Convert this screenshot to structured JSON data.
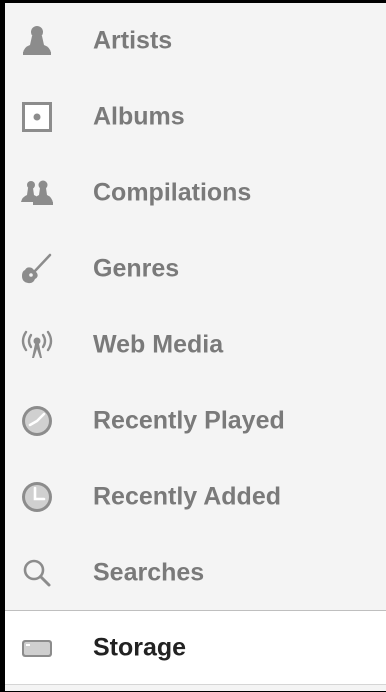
{
  "menu": {
    "items": [
      {
        "label": "Artists",
        "icon": "artist-icon"
      },
      {
        "label": "Albums",
        "icon": "album-icon"
      },
      {
        "label": "Compilations",
        "icon": "compilations-icon"
      },
      {
        "label": "Genres",
        "icon": "guitar-icon"
      },
      {
        "label": "Web Media",
        "icon": "broadcast-icon"
      },
      {
        "label": "Recently Played",
        "icon": "clock-icon"
      },
      {
        "label": "Recently Added",
        "icon": "clock-icon"
      },
      {
        "label": "Searches",
        "icon": "search-icon"
      }
    ],
    "storage": {
      "label": "Storage",
      "icon": "drive-icon"
    }
  },
  "colors": {
    "menu_background": "#f4f4f4",
    "icon_gray": "#8c8c8c",
    "label_gray": "#7a7a7a",
    "selected_label": "#222222"
  }
}
